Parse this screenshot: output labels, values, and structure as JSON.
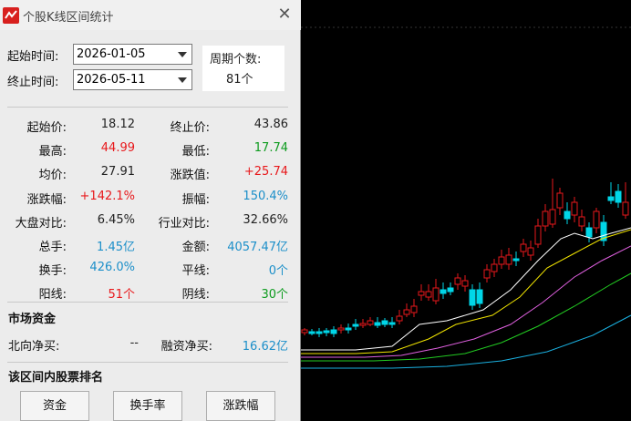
{
  "window": {
    "title": "个股K线区间统计",
    "close_glyph": "✕"
  },
  "range": {
    "start_label": "起始时间:",
    "start_value": "2026-01-05",
    "end_label": "终止时间:",
    "end_value": "2026-05-11"
  },
  "period": {
    "label": "周期个数:",
    "value": "81个"
  },
  "stats": [
    {
      "left_label": "起始价:",
      "left_value": "18.12",
      "left_color": "black",
      "right_label": "终止价:",
      "right_value": "43.86",
      "right_color": "black"
    },
    {
      "left_label": "最高:",
      "left_value": "44.99",
      "left_color": "red",
      "right_label": "最低:",
      "right_value": "17.74",
      "right_color": "green"
    },
    {
      "left_label": "均价:",
      "left_value": "27.91",
      "left_color": "black",
      "right_label": "涨跌值:",
      "right_value": "+25.74",
      "right_color": "red"
    },
    {
      "left_label": "涨跌幅:",
      "left_value": "+142.1%",
      "left_color": "red",
      "right_label": "振幅:",
      "right_value": "150.4%",
      "right_color": "blue"
    },
    {
      "left_label": "大盘对比:",
      "left_value": "6.45%",
      "left_color": "black",
      "right_label": "行业对比:",
      "right_value": "32.66%",
      "right_color": "black"
    },
    {
      "left_label": "总手:",
      "left_value": "1.45亿",
      "left_color": "blue",
      "right_label": "金额:",
      "right_value": "4057.47亿",
      "right_color": "blue"
    },
    {
      "left_label": "换手:",
      "left_value": "426.0%",
      "left_color": "blue",
      "right_label": "平线:",
      "right_value": "0个",
      "right_color": "blue"
    },
    {
      "left_label": "阳线:",
      "left_value": "51个",
      "left_color": "red",
      "right_label": "阴线:",
      "right_value": "30个",
      "right_color": "green"
    }
  ],
  "market_funds": {
    "title": "市场资金",
    "north_label": "北向净买:",
    "north_value": "--",
    "margin_label": "融资净买:",
    "margin_value": "16.62亿"
  },
  "ranking": {
    "title": "该区间内股票排名",
    "buttons": [
      "资金",
      "换手率",
      "涨跌幅"
    ]
  },
  "colors": {
    "up": "#e8181b",
    "down": "#00d6e8",
    "ma1": "#ffffff",
    "ma2": "#f2e500",
    "ma3": "#e060e0",
    "ma4": "#22cc22",
    "ma5": "#1ab0e0"
  }
}
